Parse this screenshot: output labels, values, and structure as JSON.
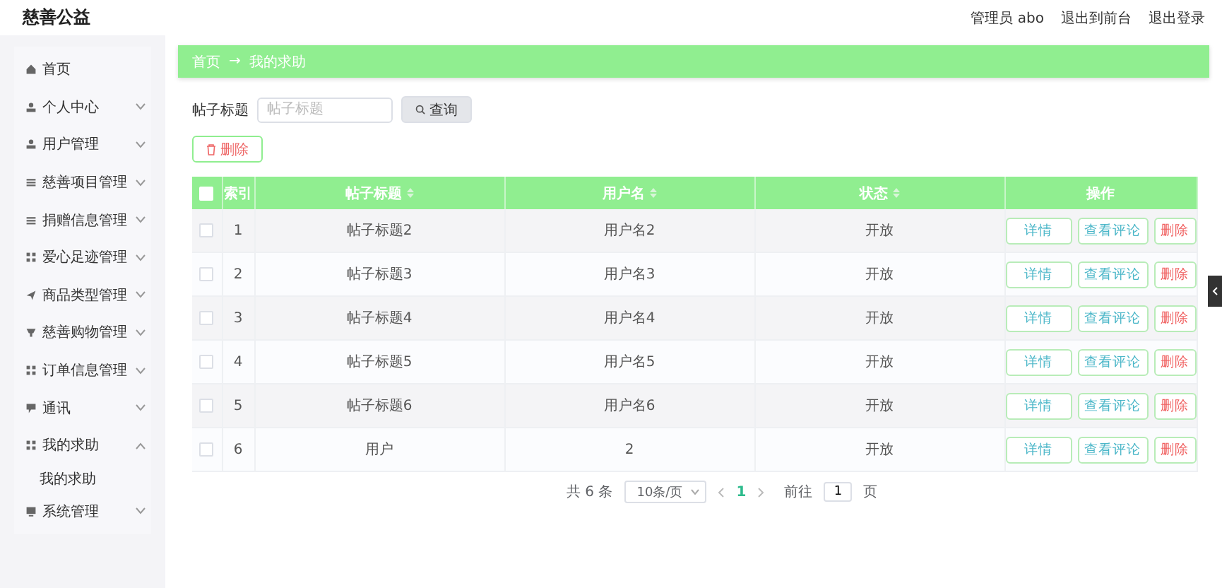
{
  "header": {
    "title": "慈善公益",
    "user_label": "管理员 abo",
    "links": [
      "退出到前台",
      "退出登录"
    ]
  },
  "sidebar": {
    "items": [
      {
        "label": "首页",
        "kind": "link"
      },
      {
        "label": "个人中心",
        "kind": "menu",
        "expanded": false
      },
      {
        "label": "用户管理",
        "kind": "menu",
        "expanded": false
      },
      {
        "label": "慈善项目管理",
        "kind": "menu",
        "expanded": false
      },
      {
        "label": "捐赠信息管理",
        "kind": "menu",
        "expanded": false
      },
      {
        "label": "爱心足迹管理",
        "kind": "menu",
        "expanded": false
      },
      {
        "label": "商品类型管理",
        "kind": "menu",
        "expanded": false
      },
      {
        "label": "慈善购物管理",
        "kind": "menu",
        "expanded": false
      },
      {
        "label": "订单信息管理",
        "kind": "menu",
        "expanded": false
      },
      {
        "label": "通讯",
        "kind": "menu",
        "expanded": false
      },
      {
        "label": "我的求助",
        "kind": "menu",
        "expanded": true,
        "children": [
          {
            "label": "我的求助"
          }
        ]
      },
      {
        "label": "系统管理",
        "kind": "menu",
        "expanded": false
      }
    ]
  },
  "breadcrumb": {
    "items": [
      "首页",
      "我的求助"
    ],
    "separator": "→"
  },
  "search": {
    "label": "帖子标题",
    "placeholder": "帖子标题",
    "button": "查询"
  },
  "delete_button": "删除",
  "table": {
    "select_all": {
      "checked": false
    },
    "columns": [
      {
        "label": "索引",
        "sortable": false
      },
      {
        "label": "帖子标题",
        "sortable": true
      },
      {
        "label": "用户名",
        "sortable": true
      },
      {
        "label": "状态",
        "sortable": true
      },
      {
        "label": "操作",
        "sortable": false
      }
    ],
    "rows": [
      {
        "checked": false,
        "cells": [
          "1",
          "帖子标题2",
          "用户名2",
          "开放"
        ],
        "actions": [
          {
            "label": "详情",
            "kind": "info"
          },
          {
            "label": "查看评论",
            "kind": "info"
          },
          {
            "label": "删除",
            "kind": "danger"
          }
        ]
      },
      {
        "checked": false,
        "cells": [
          "2",
          "帖子标题3",
          "用户名3",
          "开放"
        ],
        "actions": [
          {
            "label": "详情",
            "kind": "info"
          },
          {
            "label": "查看评论",
            "kind": "info"
          },
          {
            "label": "删除",
            "kind": "danger"
          }
        ]
      },
      {
        "checked": false,
        "cells": [
          "3",
          "帖子标题4",
          "用户名4",
          "开放"
        ],
        "actions": [
          {
            "label": "详情",
            "kind": "info"
          },
          {
            "label": "查看评论",
            "kind": "info"
          },
          {
            "label": "删除",
            "kind": "danger"
          }
        ]
      },
      {
        "checked": false,
        "cells": [
          "4",
          "帖子标题5",
          "用户名5",
          "开放"
        ],
        "actions": [
          {
            "label": "详情",
            "kind": "info"
          },
          {
            "label": "查看评论",
            "kind": "info"
          },
          {
            "label": "删除",
            "kind": "danger"
          }
        ]
      },
      {
        "checked": false,
        "cells": [
          "5",
          "帖子标题6",
          "用户名6",
          "开放"
        ],
        "actions": [
          {
            "label": "详情",
            "kind": "info"
          },
          {
            "label": "查看评论",
            "kind": "info"
          },
          {
            "label": "删除",
            "kind": "danger"
          }
        ]
      },
      {
        "checked": false,
        "cells": [
          "6",
          "用户",
          "2",
          "开放"
        ],
        "actions": [
          {
            "label": "详情",
            "kind": "info"
          },
          {
            "label": "查看评论",
            "kind": "info"
          },
          {
            "label": "删除",
            "kind": "danger"
          }
        ]
      }
    ]
  },
  "pagination": {
    "total": "共 6 条",
    "page_size": "10条/页",
    "pages": [
      {
        "label": "1",
        "selected": true
      }
    ],
    "goto_label": "前往",
    "goto_value": "1",
    "goto_suffix": "页"
  }
}
